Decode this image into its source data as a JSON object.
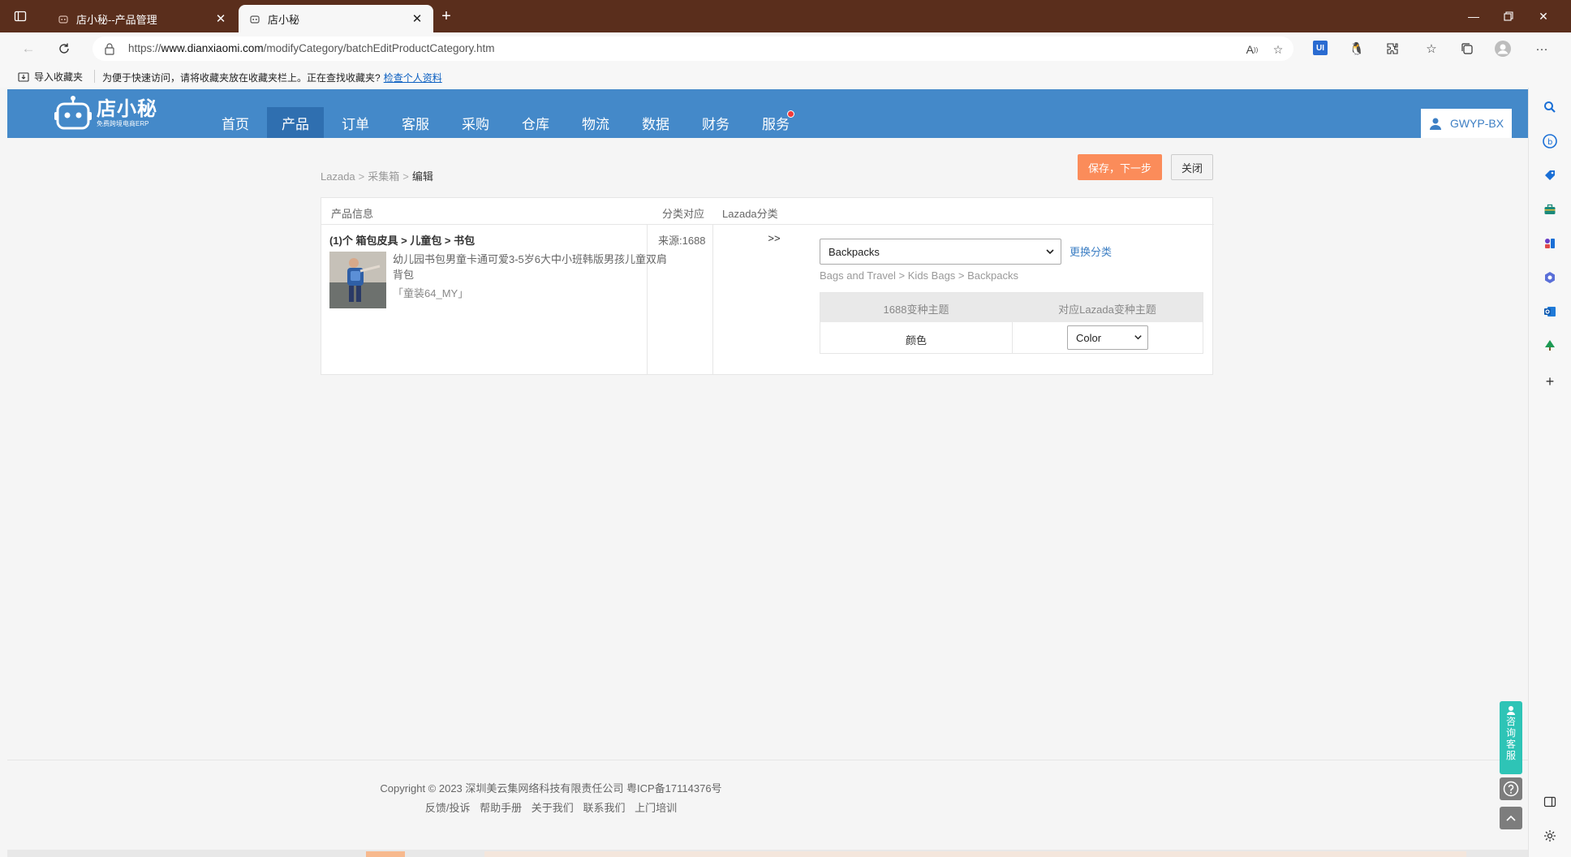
{
  "browser": {
    "tabs": [
      {
        "title": "店小秘--产品管理",
        "active": false
      },
      {
        "title": "店小秘",
        "active": true
      }
    ],
    "url_prefix": "https://",
    "url_host": "www.dianxiaomi.com",
    "url_path": "/modifyCategory/batchEditProductCategory.htm",
    "favbar": {
      "import_label": "导入收藏夹",
      "hint": "为便于快速访问，请将收藏夹放在收藏夹栏上。正在查找收藏夹?",
      "hint_link": "检查个人资料"
    }
  },
  "app": {
    "brand": "店小秘",
    "slogan": "免费跨境电商ERP",
    "nav": [
      {
        "label": "首页",
        "active": false
      },
      {
        "label": "产品",
        "active": true
      },
      {
        "label": "订单",
        "active": false
      },
      {
        "label": "客服",
        "active": false
      },
      {
        "label": "采购",
        "active": false
      },
      {
        "label": "仓库",
        "active": false
      },
      {
        "label": "物流",
        "active": false
      },
      {
        "label": "数据",
        "active": false
      },
      {
        "label": "财务",
        "active": false
      },
      {
        "label": "服务",
        "active": false,
        "badge": true
      }
    ],
    "user": "GWYP-BX"
  },
  "breadcrumb": {
    "level1": "Lazada",
    "level2": "采集箱",
    "current": "编辑",
    "separator": ">"
  },
  "actions": {
    "save_next": "保存，下一步",
    "close": "关闭"
  },
  "panel": {
    "headers": {
      "product_info": "产品信息",
      "mapping": "分类对应",
      "lazada_category": "Lazada分类"
    },
    "product": {
      "category_path": "(1)个 箱包皮具 > 儿童包 > 书包",
      "source": "来源:1688",
      "name": "幼儿园书包男童卡通可爱3-5岁6大中小班韩版男孩儿童双肩背包",
      "sku": "「童装64_MY」"
    },
    "arrow": ">>",
    "lazada": {
      "selected_category": "Backpacks",
      "change_link": "更换分类",
      "full_path": "Bags and Travel > Kids Bags > Backpacks"
    },
    "variant_table": {
      "headers": [
        "1688变种主题",
        "对应Lazada变种主题"
      ],
      "rows": [
        {
          "source_theme": "颜色",
          "lazada_theme": "Color"
        }
      ]
    }
  },
  "footer": {
    "copyright": "Copyright © 2023 深圳美云集网络科技有限责任公司  粤ICP备17114376号",
    "links": [
      "反馈/投诉",
      "帮助手册",
      "关于我们",
      "联系我们",
      "上门培训"
    ]
  },
  "floating": {
    "service_chars": [
      "咨",
      "询",
      "客",
      "服"
    ]
  },
  "colors": {
    "titlebar": "#5a2e1c",
    "appbar": "#4489c9",
    "nav_active": "#2f6fb0",
    "save_button": "#fb8c5a",
    "link": "#3d7fc4",
    "service_float": "#2ec4b6"
  }
}
